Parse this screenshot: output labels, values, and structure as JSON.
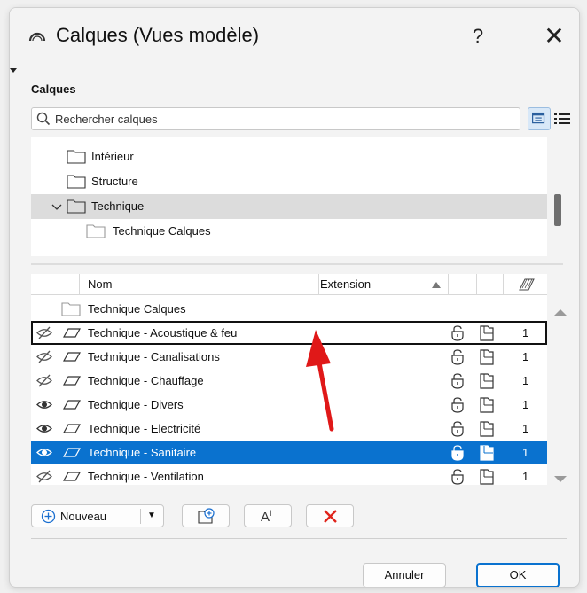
{
  "window": {
    "title": "Calques (Vues modèle)",
    "help": "?",
    "close": "✕"
  },
  "section": {
    "label": "Calques"
  },
  "search": {
    "placeholder": "Rechercher calques"
  },
  "tree": {
    "items": [
      {
        "label": "Intérieur",
        "level": 0,
        "expanded": false,
        "selected": false
      },
      {
        "label": "Structure",
        "level": 0,
        "expanded": false,
        "selected": false
      },
      {
        "label": "Technique",
        "level": 0,
        "expanded": true,
        "selected": true
      },
      {
        "label": "Technique Calques",
        "level": 1,
        "expanded": false,
        "selected": false
      }
    ]
  },
  "table": {
    "headers": {
      "name": "Nom",
      "extension": "Extension"
    },
    "group_row": "Technique Calques",
    "rows": [
      {
        "name": "Technique - Acoustique & feu",
        "visible": false,
        "num": "1",
        "selected": false,
        "outlined": true
      },
      {
        "name": "Technique - Canalisations",
        "visible": false,
        "num": "1",
        "selected": false,
        "outlined": false
      },
      {
        "name": "Technique - Chauffage",
        "visible": false,
        "num": "1",
        "selected": false,
        "outlined": false
      },
      {
        "name": "Technique - Divers",
        "visible": true,
        "num": "1",
        "selected": false,
        "outlined": false
      },
      {
        "name": "Technique - Electricité",
        "visible": true,
        "num": "1",
        "selected": false,
        "outlined": false
      },
      {
        "name": "Technique - Sanitaire",
        "visible": true,
        "num": "1",
        "selected": true,
        "outlined": false
      },
      {
        "name": "Technique - Ventilation",
        "visible": false,
        "num": "1",
        "selected": false,
        "outlined": false
      }
    ]
  },
  "toolbar": {
    "new_label": "Nouveau",
    "dropdown_arrow": "▼",
    "rename_glyph": "A",
    "rename_sup": "I"
  },
  "buttons": {
    "cancel": "Annuler",
    "ok": "OK"
  },
  "colors": {
    "selection": "#0a72cf",
    "delete": "#e0241b",
    "arrow": "#e01818",
    "tree_selection": "#dcdcdc"
  },
  "icons": [
    "folder-icon",
    "eye-icon",
    "eye-hidden-icon",
    "layer-plane-icon",
    "lock-icon",
    "wireframe-icon",
    "search-icon",
    "tree-view-icon",
    "list-view-icon",
    "add-circle-icon",
    "new-folder-icon",
    "rename-icon",
    "delete-icon",
    "annotation-arrow"
  ]
}
